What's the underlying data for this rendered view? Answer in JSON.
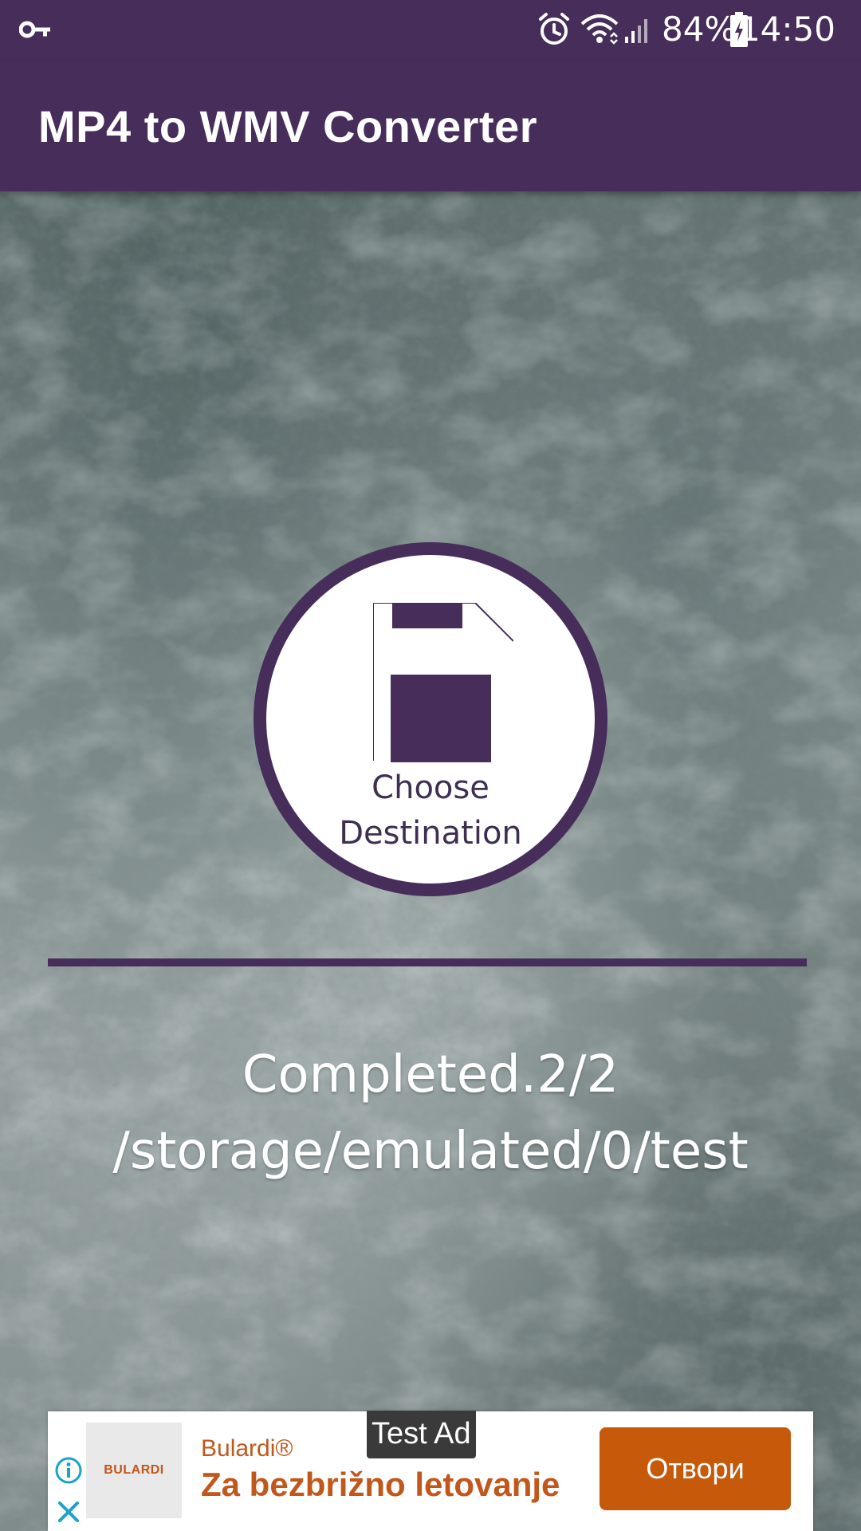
{
  "status_bar": {
    "time": "14:50",
    "battery_percent": "84%",
    "icons": [
      "vpn-key-icon",
      "alarm-icon",
      "wifi-icon",
      "signal-icon",
      "battery-charging-icon"
    ]
  },
  "app_bar": {
    "title": "MP4 to WMV Converter"
  },
  "main": {
    "choose_button": {
      "line1": "Choose",
      "line2": "Destination",
      "icon": "save-icon"
    },
    "status": {
      "line1": "Completed.2/2",
      "line2": "/storage/emulated/0/test"
    }
  },
  "ad": {
    "test_label": "Test Ad",
    "logo_text": "BULARDI",
    "advertiser": "Bulardi®",
    "headline": "Za bezbrižno letovanje",
    "cta": "Отвори",
    "icons": [
      "info-icon",
      "close-icon"
    ]
  },
  "colors": {
    "primary": "#472d5a",
    "cta": "#c65a0a",
    "ad_text": "#c2571b"
  }
}
